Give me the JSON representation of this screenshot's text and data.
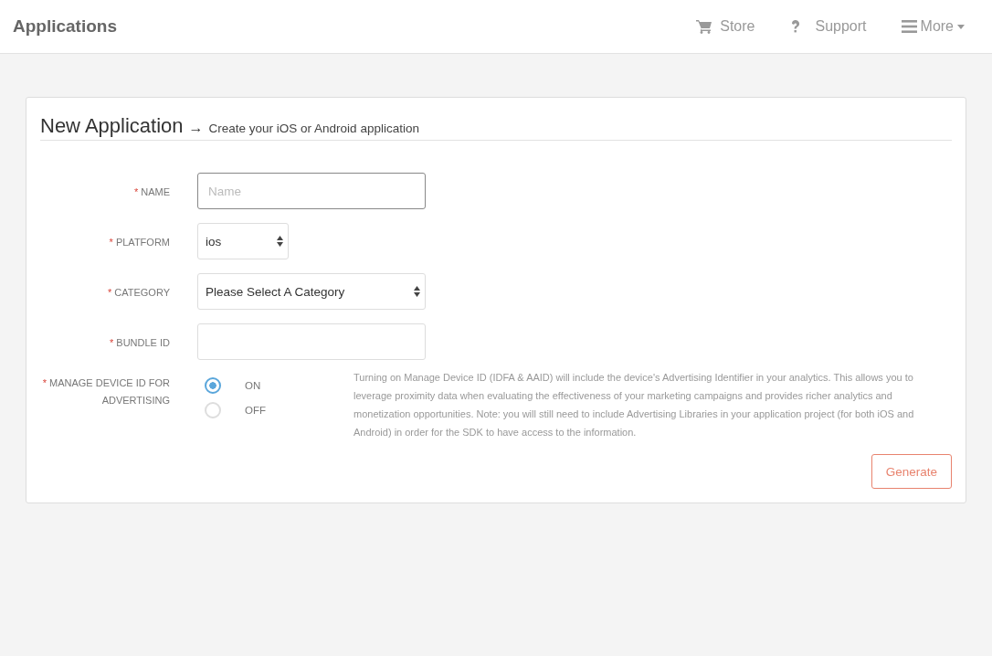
{
  "header": {
    "title": "Applications",
    "nav": [
      {
        "kind": "cart",
        "label": "Store"
      },
      {
        "kind": "question",
        "label": "Support"
      },
      {
        "kind": "menu",
        "label": "More",
        "caret": true
      }
    ]
  },
  "form": {
    "title": "New Application",
    "arrow": "→",
    "subtitle": "Create your iOS or Android application",
    "fields": [
      {
        "kind": "text",
        "required_mark": "*",
        "label": "NAME",
        "placeholder": "Name"
      },
      {
        "kind": "short-select",
        "required_mark": "*",
        "label": "PLATFORM",
        "value": "ios"
      },
      {
        "kind": "select",
        "required_mark": "*",
        "label": "CATEGORY",
        "value": "Please Select A Category"
      },
      {
        "kind": "text",
        "required_mark": "*",
        "label": "BUNDLE ID"
      },
      {
        "kind": "radio",
        "required_mark": "*",
        "label": "MANAGE DEVICE ID FOR ADVERTISING",
        "options": [
          {
            "label": "ON",
            "selected": true
          },
          {
            "label": "OFF",
            "selected": false
          }
        ],
        "help": "Turning on Manage Device ID (IDFA & AAID) will include the device's Advertising Identifier in your analytics. This allows you to leverage proximity data when evaluating the effectiveness of your marketing campaigns and provides richer analytics and monetization opportunities. Note: you will still need to include Advertising Libraries in your application project (for both iOS and Android) in order for the SDK to have access to the information."
      }
    ],
    "submit": "Generate"
  }
}
